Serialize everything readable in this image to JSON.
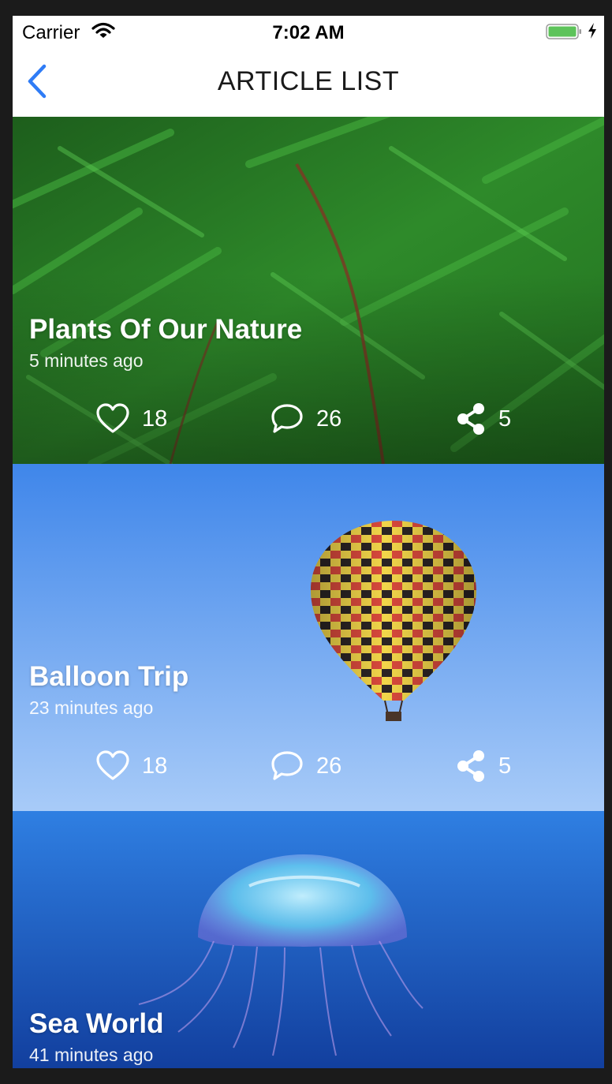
{
  "status_bar": {
    "carrier": "Carrier",
    "time": "7:02 AM"
  },
  "nav": {
    "title": "ARTICLE LIST",
    "back_icon": "chevron-left-icon",
    "accent": "#2f7cf6"
  },
  "articles": [
    {
      "title": "Plants Of Our Nature",
      "time": "5 minutes ago",
      "likes": "18",
      "comments": "26",
      "shares": "5"
    },
    {
      "title": "Balloon Trip",
      "time": "23 minutes ago",
      "likes": "18",
      "comments": "26",
      "shares": "5"
    },
    {
      "title": "Sea World",
      "time": "41 minutes ago"
    }
  ],
  "icons": {
    "like": "heart-icon",
    "comment": "comment-icon",
    "share": "share-icon"
  },
  "colors": {
    "plants": "#2e8a2a",
    "sky_top": "#3f86ea",
    "sky_bottom": "#a8cbf8",
    "sea": "#1b63cf"
  }
}
